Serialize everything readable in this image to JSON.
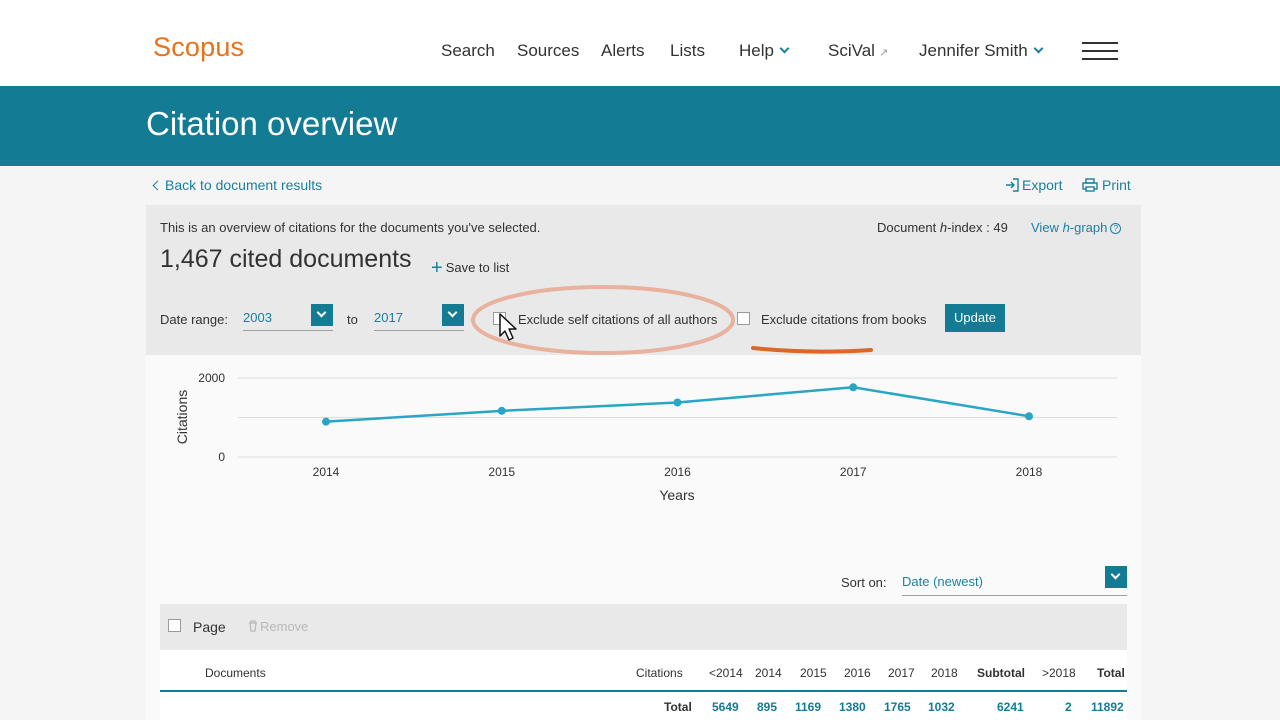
{
  "app": {
    "name": "Scopus"
  },
  "nav": {
    "search": "Search",
    "sources": "Sources",
    "alerts": "Alerts",
    "lists": "Lists",
    "help": "Help",
    "scival": "SciVal",
    "user": "Jennifer Smith"
  },
  "banner": {
    "title": "Citation overview"
  },
  "actions": {
    "back": "Back to document results",
    "export": "Export",
    "print": "Print"
  },
  "overview": {
    "intro": "This is an overview of citations for the documents you've selected.",
    "hindex_prefix": "Document ",
    "hindex_h": "h",
    "hindex_suffix": "-index : 49",
    "view_prefix": "View ",
    "view_h": "h",
    "view_suffix": "-graph",
    "cited": "1,467 cited documents",
    "save": "Save to list",
    "date_range_label": "Date range:",
    "date_from": "2003",
    "date_to_label": "to",
    "date_to": "2017",
    "exclude_self": "Exclude self citations of all authors",
    "exclude_books": "Exclude citations from books",
    "update": "Update"
  },
  "chart_data": {
    "type": "line",
    "x": [
      "2014",
      "2015",
      "2016",
      "2017",
      "2018"
    ],
    "series": [
      {
        "values": [
          895,
          1169,
          1380,
          1765,
          1032
        ]
      }
    ],
    "xlabel": "Years",
    "ylabel": "Citations",
    "yticks": [
      "0",
      "2000"
    ],
    "ylim": [
      0,
      2000
    ],
    "grid": true,
    "color": "#2ba5c4"
  },
  "sort": {
    "label": "Sort on:",
    "value": "Date (newest)"
  },
  "table": {
    "page_label": "Page",
    "remove_label": "Remove",
    "headers": {
      "documents": "Documents",
      "citations": "Citations",
      "lt2014": "<2014",
      "y2014": "2014",
      "y2015": "2015",
      "y2016": "2016",
      "y2017": "2017",
      "y2018": "2018",
      "subtotal": "Subtotal",
      "gt2018": ">2018",
      "total": "Total"
    },
    "totals": {
      "label": "Total",
      "lt2014": "5649",
      "y2014": "895",
      "y2015": "1169",
      "y2016": "1380",
      "y2017": "1765",
      "y2018": "1032",
      "subtotal": "6241",
      "gt2018": "2",
      "total": "11892"
    }
  },
  "colors": {
    "accent": "#137b94",
    "brand": "#e9711c",
    "link": "#1b7fa0",
    "highlight": "#e8a890",
    "underline": "#d9682a"
  }
}
